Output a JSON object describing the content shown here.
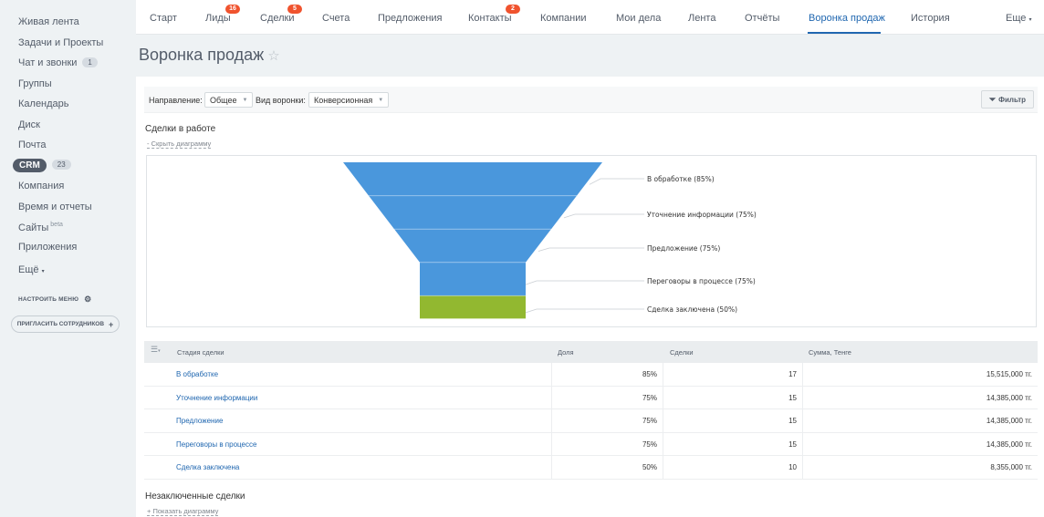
{
  "sidebar": {
    "items": [
      {
        "label": "Живая лента"
      },
      {
        "label": "Задачи и Проекты"
      },
      {
        "label": "Чат и звонки",
        "count": "1"
      },
      {
        "label": "Группы"
      },
      {
        "label": "Календарь"
      },
      {
        "label": "Диск"
      },
      {
        "label": "Почта"
      },
      {
        "label": "CRM",
        "count": "23"
      },
      {
        "label": "Компания"
      },
      {
        "label": "Время и отчеты"
      },
      {
        "label": "Сайты",
        "sup": "beta"
      },
      {
        "label": "Приложения"
      },
      {
        "label": "Ещё"
      }
    ],
    "configure_label": "НАСТРОИТЬ МЕНЮ",
    "invite_label": "ПРИГЛАСИТЬ СОТРУДНИКОВ"
  },
  "topnav": {
    "items": [
      {
        "label": "Старт"
      },
      {
        "label": "Лиды",
        "badge": "16"
      },
      {
        "label": "Сделки",
        "badge": "5"
      },
      {
        "label": "Счета"
      },
      {
        "label": "Предложения"
      },
      {
        "label": "Контакты",
        "badge": "2"
      },
      {
        "label": "Компании"
      },
      {
        "label": "Мои дела"
      },
      {
        "label": "Лента"
      },
      {
        "label": "Отчёты"
      },
      {
        "label": "Воронка продаж",
        "active": true
      },
      {
        "label": "История"
      },
      {
        "label": "Еще"
      }
    ]
  },
  "page": {
    "title": "Воронка продаж"
  },
  "filter": {
    "direction_label": "Направление:",
    "direction_value": "Общее",
    "funnel_label": "Вид воронки:",
    "funnel_value": "Конверсионная",
    "filter_button": "Фильтр"
  },
  "sections": {
    "in_work_title": "Сделки в работе",
    "hide_chart": "Скрыть диаграмму",
    "unclosed_title": "Незаключенные сделки",
    "show_chart": "Показать диаграмму"
  },
  "chart_data": {
    "type": "funnel",
    "stages": [
      {
        "label": "В обработке (85%)",
        "percent": 85,
        "color": "#4a97dc"
      },
      {
        "label": "Уточнение информации (75%)",
        "percent": 75,
        "color": "#4a97dc"
      },
      {
        "label": "Предложение (75%)",
        "percent": 75,
        "color": "#4a97dc"
      },
      {
        "label": "Переговоры в процессе (75%)",
        "percent": 75,
        "color": "#4a97dc"
      },
      {
        "label": "Сделка заключена (50%)",
        "percent": 50,
        "color": "#92b830"
      }
    ]
  },
  "table": {
    "headers": {
      "stage": "Стадия сделки",
      "share": "Доля",
      "deals": "Сделки",
      "sum": "Сумма, Тенге"
    },
    "rows": [
      {
        "stage": "В обработке",
        "share": "85%",
        "deals": "17",
        "sum": "15,515,000 тг."
      },
      {
        "stage": "Уточнение информации",
        "share": "75%",
        "deals": "15",
        "sum": "14,385,000 тг."
      },
      {
        "stage": "Предложение",
        "share": "75%",
        "deals": "15",
        "sum": "14,385,000 тг."
      },
      {
        "stage": "Переговоры в процессе",
        "share": "75%",
        "deals": "15",
        "sum": "14,385,000 тг."
      },
      {
        "stage": "Сделка заключена",
        "share": "50%",
        "deals": "10",
        "sum": "8,355,000 тг."
      }
    ]
  }
}
